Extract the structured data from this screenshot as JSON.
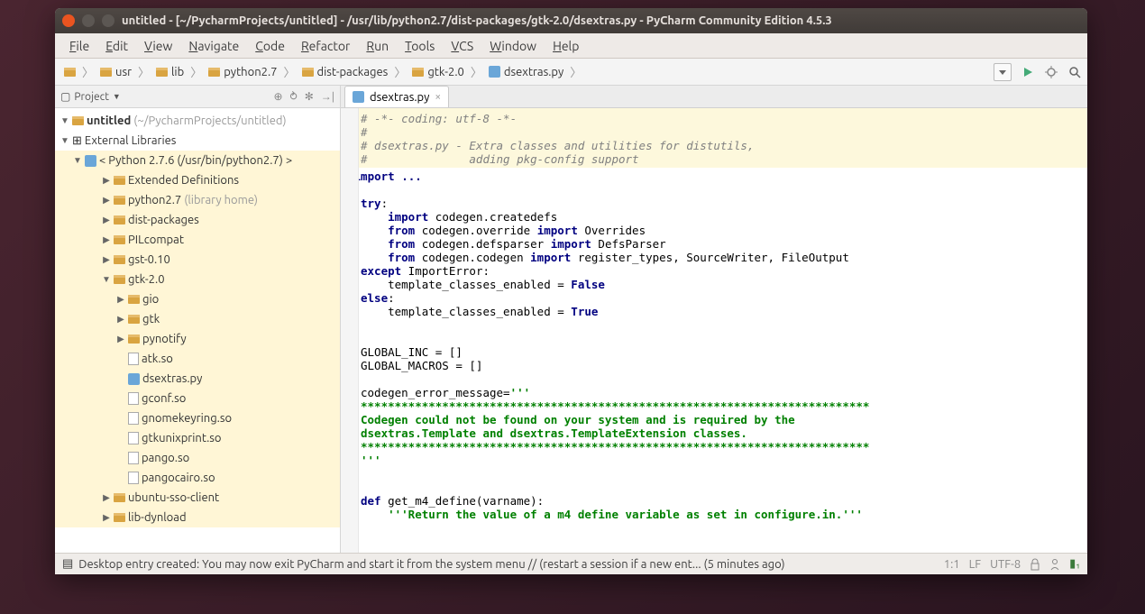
{
  "title": "untitled - [~/PycharmProjects/untitled] - /usr/lib/python2.7/dist-packages/gtk-2.0/dsextras.py - PyCharm Community Edition 4.5.3",
  "menubar": [
    "File",
    "Edit",
    "View",
    "Navigate",
    "Code",
    "Refactor",
    "Run",
    "Tools",
    "VCS",
    "Window",
    "Help"
  ],
  "breadcrumbs": [
    {
      "icon": "folder",
      "label": ""
    },
    {
      "icon": "folder",
      "label": "usr"
    },
    {
      "icon": "folder",
      "label": "lib"
    },
    {
      "icon": "folder",
      "label": "python2.7"
    },
    {
      "icon": "folder",
      "label": "dist-packages"
    },
    {
      "icon": "folder",
      "label": "gtk-2.0"
    },
    {
      "icon": "py",
      "label": "dsextras.py"
    }
  ],
  "sidebar_title": "Project",
  "tree": {
    "root": {
      "label": "untitled",
      "hint": "(~/PycharmProjects/untitled)"
    },
    "extlib": "External Libraries",
    "python": {
      "label": "< Python 2.7.6 (/usr/bin/python2.7) >"
    },
    "items": [
      {
        "ind": 3,
        "arrow": "▶",
        "icon": "folder",
        "label": "Extended Definitions"
      },
      {
        "ind": 3,
        "arrow": "▶",
        "icon": "folder",
        "label": "python2.7",
        "hint": "(library home)"
      },
      {
        "ind": 3,
        "arrow": "▶",
        "icon": "folder",
        "label": "dist-packages"
      },
      {
        "ind": 3,
        "arrow": "▶",
        "icon": "folder",
        "label": "PILcompat"
      },
      {
        "ind": 3,
        "arrow": "▶",
        "icon": "folder",
        "label": "gst-0.10"
      },
      {
        "ind": 3,
        "arrow": "▼",
        "icon": "folder",
        "label": "gtk-2.0",
        "open": true
      },
      {
        "ind": 4,
        "arrow": "▶",
        "icon": "folder",
        "label": "gio"
      },
      {
        "ind": 4,
        "arrow": "▶",
        "icon": "folder",
        "label": "gtk"
      },
      {
        "ind": 4,
        "arrow": "▶",
        "icon": "folder",
        "label": "pynotify"
      },
      {
        "ind": 4,
        "arrow": "",
        "icon": "file",
        "label": "atk.so"
      },
      {
        "ind": 4,
        "arrow": "",
        "icon": "py",
        "label": "dsextras.py",
        "sel": true
      },
      {
        "ind": 4,
        "arrow": "",
        "icon": "file",
        "label": "gconf.so"
      },
      {
        "ind": 4,
        "arrow": "",
        "icon": "file",
        "label": "gnomekeyring.so"
      },
      {
        "ind": 4,
        "arrow": "",
        "icon": "file",
        "label": "gtkunixprint.so"
      },
      {
        "ind": 4,
        "arrow": "",
        "icon": "file",
        "label": "pango.so"
      },
      {
        "ind": 4,
        "arrow": "",
        "icon": "file",
        "label": "pangocairo.so"
      },
      {
        "ind": 3,
        "arrow": "▶",
        "icon": "folder",
        "label": "ubuntu-sso-client"
      },
      {
        "ind": 3,
        "arrow": "▶",
        "icon": "folder",
        "label": "lib-dynload"
      }
    ]
  },
  "tab": "dsextras.py",
  "code_comment_block": "# -*- coding: utf-8 -*-\n#\n# dsextras.py - Extra classes and utilities for distutils,\n#               adding pkg-config support",
  "code": {
    "imp": "import ...",
    "l_try": "try",
    "l_imp1": "import",
    "l_imp1b": " codegen.createdefs",
    "l_from": "from",
    "l_imp2a": " codegen.override ",
    "l_imp2b": "import",
    "l_imp2c": " Overrides",
    "l_imp3a": " codegen.defsparser ",
    "l_imp3b": "import",
    "l_imp3c": " DefsParser",
    "l_imp4a": " codegen.codegen ",
    "l_imp4b": "import",
    "l_imp4c": " register_types, SourceWriter, FileOutput",
    "l_except": "except",
    "l_except_b": " ImportError:",
    "l_tce_f": "    template_classes_enabled = ",
    "l_false": "False",
    "l_else": "else",
    "l_true": "True",
    "l_ginc": "GLOBAL_INC = []",
    "l_gmac": "GLOBAL_MACROS = []",
    "l_errm": "codegen_error_message=",
    "l_tqt": "'''",
    "l_stars": "***************************************************************************",
    "l_msg1": "Codegen could not be found on your system and is required by the",
    "l_msg2": "dsextras.Template and dsextras.TemplateExtension classes.",
    "l_def": "def",
    "l_defn": " get_m4_define(varname):",
    "l_doc": "    '''Return the value of a m4 define variable as set in configure.in.'''"
  },
  "status": {
    "msg": "Desktop entry created: You may now exit PyCharm and start it from the system menu // (restart a session if a new ent... (5 minutes ago)",
    "pos": "1:1",
    "le": "LF",
    "enc": "UTF-8"
  }
}
